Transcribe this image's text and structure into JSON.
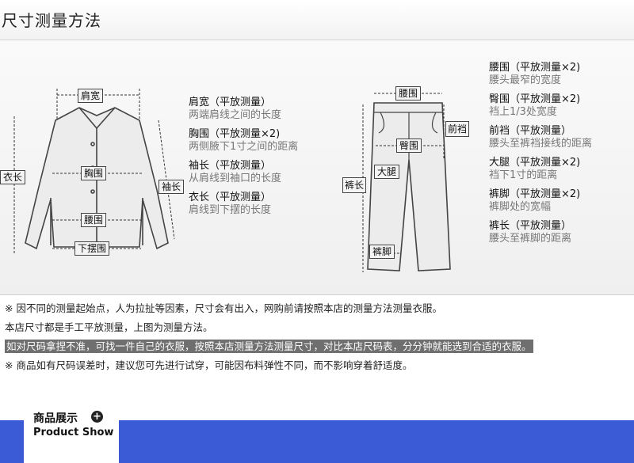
{
  "header": {
    "title": "尺寸测量方法"
  },
  "shirt": {
    "labels": {
      "shoulder": "肩宽",
      "chest": "胸围",
      "length": "衣长",
      "sleeve": "袖长",
      "waist": "腰围",
      "hem": "下摆围"
    }
  },
  "pants": {
    "labels": {
      "waist": "腰围",
      "rise": "前裆",
      "hip": "臀围",
      "thigh": "大腿",
      "length": "裤长",
      "leg_opening": "裤脚"
    }
  },
  "shirt_desc": [
    {
      "head": "肩宽（平放测量）",
      "sub": "两端肩线之间的长度"
    },
    {
      "head": "胸围（平放测量×2)",
      "sub": "两侧腋下1寸之间的距离"
    },
    {
      "head": "袖长（平放测量）",
      "sub": "从肩线到袖口的长度"
    },
    {
      "head": "衣长（平放测量）",
      "sub": "肩线到下摆的长度"
    }
  ],
  "pants_desc": [
    {
      "head": "腰围（平放测量×2)",
      "sub": "腰头最窄的宽度"
    },
    {
      "head": "臀围（平放测量×2)",
      "sub": "裆上1/3处宽度"
    },
    {
      "head": "前裆（平放测量）",
      "sub": "腰头至裤裆接线的距离"
    },
    {
      "head": "大腿（平放测量×2)",
      "sub": "裆下1寸的距离"
    },
    {
      "head": "裤脚（平放测量×2)",
      "sub": "裤脚处的宽幅"
    },
    {
      "head": "裤长（平放测量）",
      "sub": "腰头至裤脚的距离"
    }
  ],
  "notes": [
    "※ 因不同的测量起始点，人为拉扯等因素，尺寸会有出入，网购前请按照本店的测量方法测量衣服。",
    "本店尺寸都是手工平放测量，上图为测量方法。",
    "如对尺码拿捏不准，可找一件自己的衣服，按照本店测量方法测量尺寸，对比本店尺码表，分分钟就能选到合适的衣服。",
    "※ 商品如有尺码误差时，建议您可先进行试穿，可能因布料弹性不同，而不影响穿着舒适度。"
  ],
  "showcase": {
    "title_cn": "商品展示",
    "title_en": "Product Show",
    "accent": "#3b5bd6"
  }
}
